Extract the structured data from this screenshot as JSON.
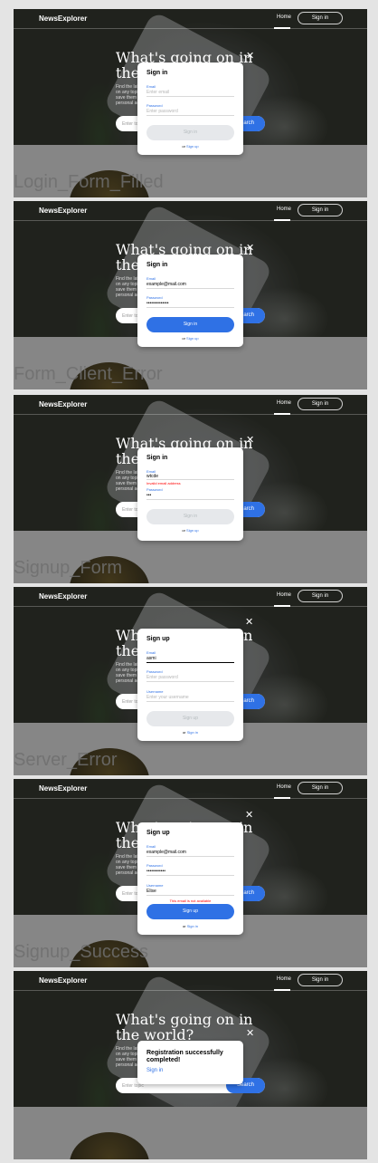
{
  "header": {
    "logo": "NewsExplorer",
    "home": "Home",
    "signin": "Sign in"
  },
  "hero": {
    "title": "What's going on in the world?",
    "subtitle": "Find the latest news on any topic and save them in your personal account.",
    "search_placeholder": "Enter topic",
    "search_button": "Search"
  },
  "captions": {
    "login_filled": "Login_Form_Filled",
    "form_client_error": "Form_Client_Error",
    "signup_form": "Signup_Form",
    "server_error": "Server_Error",
    "signup_success": "Signup_Success"
  },
  "frames": [
    {
      "title": "Sign in",
      "email_label": "Email",
      "email_placeholder": "Enter email",
      "password_label": "Password",
      "password_placeholder": "Enter password",
      "button": "Sign in",
      "or": "or",
      "alt_link": "Sign up"
    },
    {
      "title": "Sign in",
      "email_label": "Email",
      "email_value": "example@mail.com",
      "password_label": "Password",
      "password_value": "••••••••••••••",
      "button": "Sign in",
      "or": "or",
      "alt_link": "Sign up"
    },
    {
      "title": "Sign in",
      "email_label": "Email",
      "email_value": "wtcde",
      "email_error": "Invalid email address",
      "password_label": "Password",
      "password_value": "•••",
      "button": "Sign in",
      "or": "or",
      "alt_link": "Sign up"
    },
    {
      "title": "Sign up",
      "email_label": "Email",
      "email_value": "asmi",
      "password_label": "Password",
      "password_placeholder": "Enter password",
      "username_label": "Username",
      "username_placeholder": "Enter your username",
      "button": "Sign up",
      "or": "or",
      "alt_link": "Sign in"
    },
    {
      "title": "Sign up",
      "email_label": "Email",
      "email_value": "example@mail.com",
      "password_label": "Password",
      "password_value": "••••••••••••",
      "username_label": "Username",
      "username_value": "Elise",
      "server_error": "This email is not available",
      "button": "Sign up",
      "or": "or",
      "alt_link": "Sign in"
    },
    {
      "success_title": "Registration successfully completed!",
      "success_link": "Sign in"
    }
  ],
  "close_glyph": "✕"
}
